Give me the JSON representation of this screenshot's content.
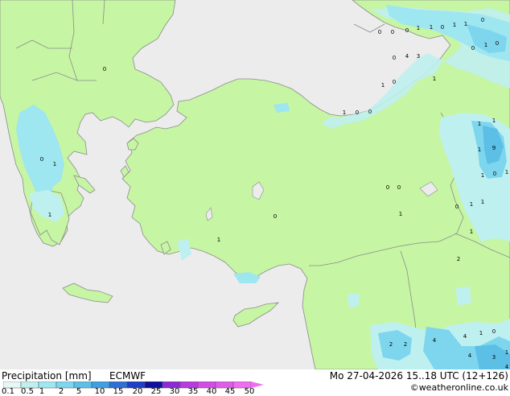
{
  "footer": {
    "title": "Precipitation [mm]",
    "model": "ECMWF",
    "datetime": "Mo 27-04-2026 15..18 UTC (12+126)",
    "copyright": "©weatheronline.co.uk"
  },
  "legend": {
    "ticks": [
      "0.1",
      "0.5",
      "1",
      "2",
      "5",
      "10",
      "15",
      "20",
      "25",
      "30",
      "35",
      "40",
      "45",
      "50"
    ],
    "colors": [
      "#e6f7f7",
      "#bff0f0",
      "#9ee6f0",
      "#7dd6ee",
      "#5cbfe6",
      "#3f9fe0",
      "#2f6fd6",
      "#1f3fc6",
      "#100f9e",
      "#8c2bd6",
      "#b83be0",
      "#d44ce6",
      "#e05ce8",
      "#f06cf0"
    ]
  },
  "map_values": [
    "0",
    "0",
    "0",
    "1",
    "1",
    "0",
    "1",
    "1",
    "0",
    "0",
    "4",
    "3",
    "0",
    "1",
    "0",
    "1",
    "0",
    "1",
    "1",
    "0",
    "0",
    "0",
    "0",
    "1",
    "1",
    "0",
    "1",
    "0",
    "0",
    "1",
    "1",
    "1",
    "1",
    "9",
    "1",
    "0",
    "1",
    "0",
    "1",
    "1",
    "1",
    "2",
    "2",
    "2",
    "4",
    "4",
    "1",
    "0",
    "4",
    "3",
    "1",
    "4"
  ],
  "colors": {
    "land": "#c6f5a3",
    "sea": "#ececec",
    "border": "#8c8c8c"
  }
}
